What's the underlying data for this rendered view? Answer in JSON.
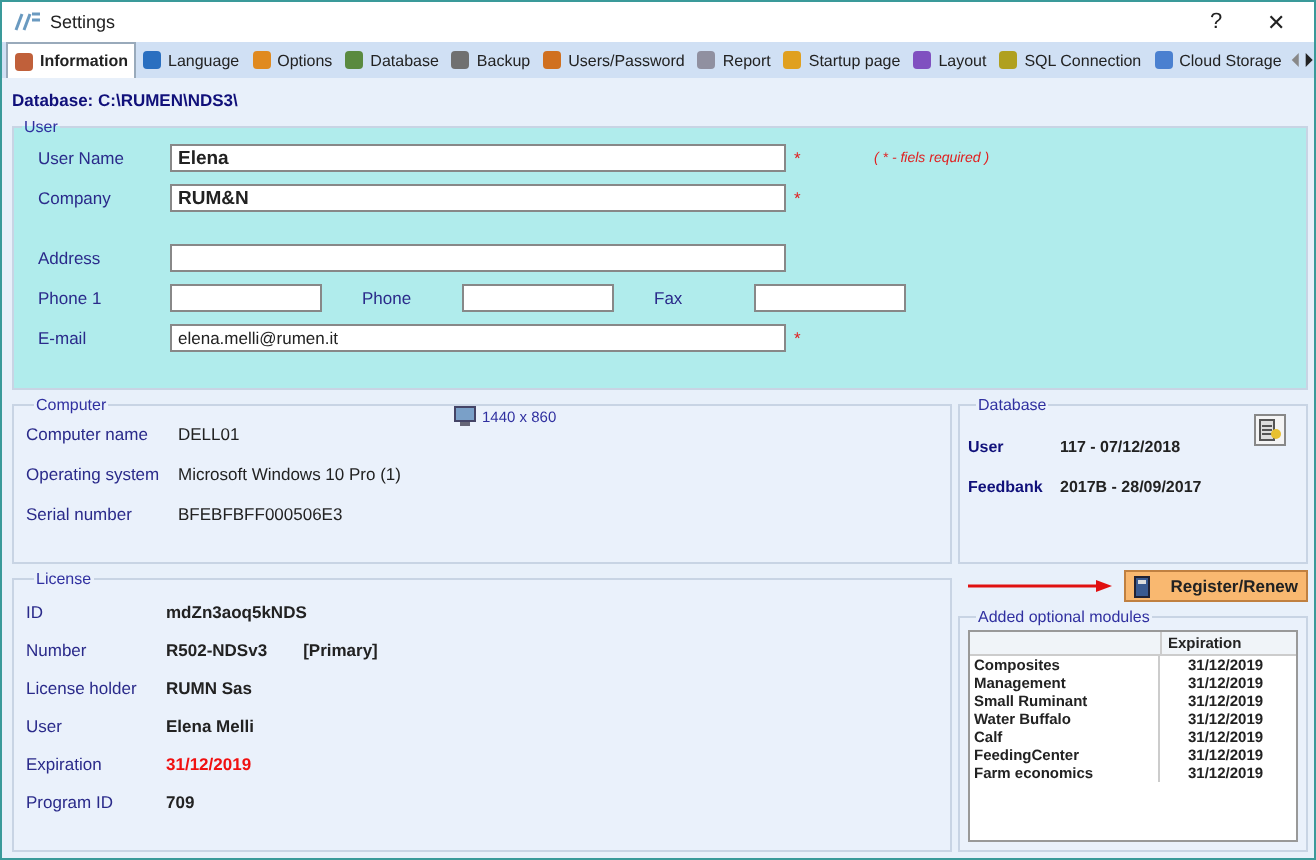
{
  "window": {
    "title": "Settings",
    "help": "?",
    "close": "✕"
  },
  "tabs": [
    {
      "label": "Information",
      "selected": true
    },
    {
      "label": "Language",
      "selected": false
    },
    {
      "label": "Options",
      "selected": false
    },
    {
      "label": "Database",
      "selected": false
    },
    {
      "label": "Backup",
      "selected": false
    },
    {
      "label": "Users/Password",
      "selected": false
    },
    {
      "label": "Report",
      "selected": false
    },
    {
      "label": "Startup page",
      "selected": false
    },
    {
      "label": "Layout",
      "selected": false
    },
    {
      "label": "SQL Connection",
      "selected": false
    },
    {
      "label": "Cloud Storage",
      "selected": false
    }
  ],
  "database_path": "Database: C:\\RUMEN\\NDS3\\",
  "user": {
    "title": "User",
    "required_mark": "*",
    "note": "( * - fiels required )",
    "rows": [
      {
        "fields": [
          {
            "label": "User Name",
            "value": "Elena",
            "bold": true,
            "required": true
          }
        ]
      },
      {
        "fields": [
          {
            "label": "Company",
            "value": "RUM&N",
            "bold": true,
            "required": true
          }
        ]
      },
      {
        "fields": [
          {
            "label": "Address",
            "required": false
          }
        ]
      },
      {
        "fields": [
          {
            "label": "Phone 1",
            "required": false
          },
          {
            "label": "Phone",
            "required": false
          },
          {
            "label": "Fax",
            "required": false
          }
        ]
      },
      {
        "fields": [
          {
            "label": "E-mail",
            "value": "elena.melli@rumen.it",
            "bold": false,
            "required": true
          }
        ]
      }
    ]
  },
  "computer": {
    "title": "Computer",
    "resolution": "1440 x 860",
    "rows": [
      {
        "label": "Computer name",
        "value": "DELL01"
      },
      {
        "label": "Operating system",
        "value": "Microsoft Windows 10 Pro  (1)"
      },
      {
        "label": "Serial number",
        "value": "BFEBFBFF000506E3"
      }
    ]
  },
  "database": {
    "title": "Database",
    "rows": [
      {
        "label": "User",
        "value": "117  -  07/12/2018"
      },
      {
        "label": "Feedbank",
        "value": "2017B  -  28/09/2017"
      }
    ]
  },
  "license": {
    "title": "License",
    "rows": [
      {
        "label": "ID",
        "value": "mdZn3aoq5kNDS",
        "highlight": false
      },
      {
        "label": "Number",
        "value": "R502-NDSv3",
        "extra": "[Primary]",
        "highlight": false
      },
      {
        "label": "License holder",
        "value": "RUMN Sas",
        "highlight": false
      },
      {
        "label": "User",
        "value": "Elena Melli",
        "highlight": false
      },
      {
        "label": "Expiration",
        "value": "31/12/2019",
        "highlight": true
      },
      {
        "label": "Program ID",
        "value": "709",
        "highlight": false
      }
    ]
  },
  "register_button": "Register/Renew",
  "modules": {
    "title": "Added optional modules",
    "columns": [
      "Expiration"
    ],
    "rows": [
      {
        "name": "Composites",
        "expiration": "31/12/2019"
      },
      {
        "name": "Management",
        "expiration": "31/12/2019"
      },
      {
        "name": "Small Ruminant",
        "expiration": "31/12/2019"
      },
      {
        "name": "Water Buffalo",
        "expiration": "31/12/2019"
      },
      {
        "name": "Calf",
        "expiration": "31/12/2019"
      },
      {
        "name": "FeedingCenter",
        "expiration": "31/12/2019"
      },
      {
        "name": "Farm economics",
        "expiration": "31/12/2019"
      }
    ]
  }
}
